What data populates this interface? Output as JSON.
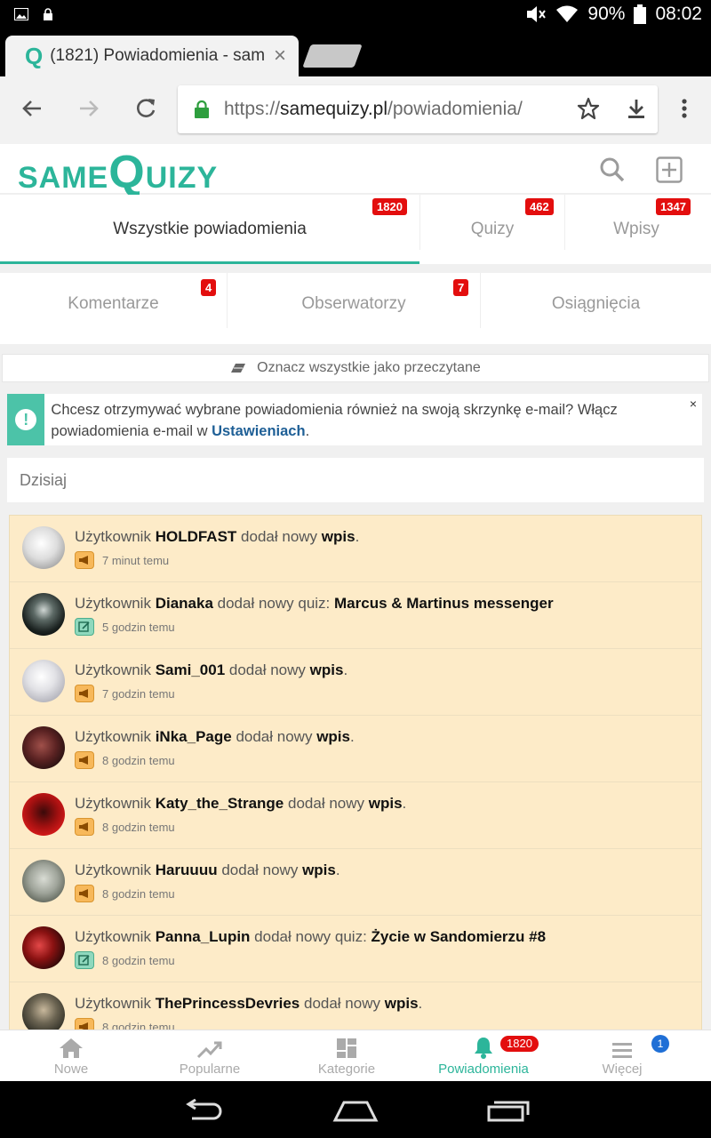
{
  "status_bar": {
    "battery": "90%",
    "time": "08:02"
  },
  "browser": {
    "tab_title": "(1821) Powiadomienia - sam",
    "url_prefix": "https://",
    "url_domain": "samequizy.pl",
    "url_path": "/powiadomienia/"
  },
  "site": {
    "logo_small": "SAME",
    "logo_big": "Q",
    "logo_rest": "UIZY"
  },
  "tabs_row1": [
    {
      "label": "Wszystkie powiadomienia",
      "badge": "1820"
    },
    {
      "label": "Quizy",
      "badge": "462"
    },
    {
      "label": "Wpisy",
      "badge": "1347"
    }
  ],
  "tabs_row2": [
    {
      "label": "Komentarze",
      "badge": "4"
    },
    {
      "label": "Obserwatorzy",
      "badge": "7"
    },
    {
      "label": "Osiągnięcia"
    }
  ],
  "mark_all": "Oznacz wszystkie jako przeczytane",
  "alert": {
    "text_before": "Chcesz otrzymywać wybrane powiadomienia również na swoją skrzynkę e-mail? Włącz powiadomienia e-mail w ",
    "link": "Ustawieniach",
    "text_after": ".",
    "close": "×"
  },
  "day_heading": "Dzisiaj",
  "notifications": [
    {
      "prefix": "Użytkownik",
      "user": "HOLDFAST",
      "action": "dodał nowy",
      "object": "wpis",
      "suffix": ".",
      "time": "7 minut temu",
      "type": "wpis"
    },
    {
      "prefix": "Użytkownik",
      "user": "Dianaka",
      "action": "dodał nowy quiz:",
      "object": "Marcus & Martinus messenger",
      "suffix": "",
      "time": "5 godzin temu",
      "type": "quiz"
    },
    {
      "prefix": "Użytkownik",
      "user": "Sami_001",
      "action": "dodał nowy",
      "object": "wpis",
      "suffix": ".",
      "time": "7 godzin temu",
      "type": "wpis"
    },
    {
      "prefix": "Użytkownik",
      "user": "iNka_Page",
      "action": "dodał nowy",
      "object": "wpis",
      "suffix": ".",
      "time": "8 godzin temu",
      "type": "wpis"
    },
    {
      "prefix": "Użytkownik",
      "user": "Katy_the_Strange",
      "action": "dodał nowy",
      "object": "wpis",
      "suffix": ".",
      "time": "8 godzin temu",
      "type": "wpis"
    },
    {
      "prefix": "Użytkownik",
      "user": "Haruuuu",
      "action": "dodał nowy",
      "object": "wpis",
      "suffix": ".",
      "time": "8 godzin temu",
      "type": "wpis"
    },
    {
      "prefix": "Użytkownik",
      "user": "Panna_Lupin",
      "action": "dodał nowy quiz:",
      "object": "Życie w Sandomierzu #8",
      "suffix": "",
      "time": "8 godzin temu",
      "type": "quiz"
    },
    {
      "prefix": "Użytkownik",
      "user": "ThePrincessDevries",
      "action": "dodał nowy",
      "object": "wpis",
      "suffix": ".",
      "time": "8 godzin temu",
      "type": "wpis"
    }
  ],
  "bottom_nav": [
    {
      "label": "Nowe",
      "icon": "home-icon"
    },
    {
      "label": "Popularne",
      "icon": "trending-icon"
    },
    {
      "label": "Kategorie",
      "icon": "grid-icon"
    },
    {
      "label": "Powiadomienia",
      "icon": "bell-icon",
      "badge": "1820"
    },
    {
      "label": "Więcej",
      "icon": "menu-icon",
      "badge": "1"
    }
  ],
  "colors": {
    "brand": "#2cb59a",
    "badge_red": "#e30e0e",
    "item_unread_bg": "#fdebc8",
    "link_blue": "#1e5f96"
  }
}
